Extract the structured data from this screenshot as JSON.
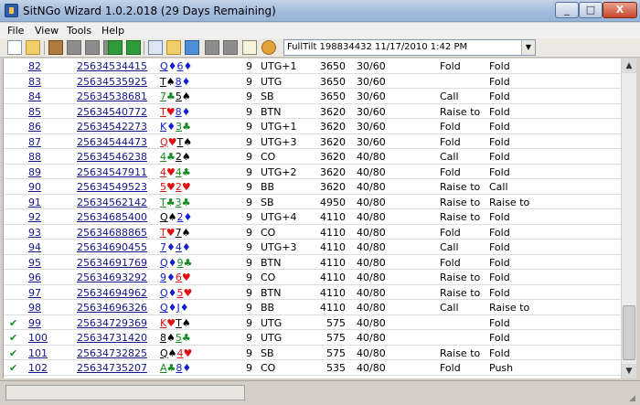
{
  "window": {
    "title": "SitNGo Wizard 1.0.2.018 (29 Days Remaining)",
    "controls": {
      "minimize": "_",
      "maximize": "□",
      "close": "X"
    }
  },
  "menu": [
    "File",
    "View",
    "Tools",
    "Help"
  ],
  "toolbar": {
    "icons": [
      "new-document-icon",
      "open-folder-icon",
      "home-icon",
      "stop-icon",
      "stop-icon",
      "stop-icon",
      "go-icon",
      "refresh-icon",
      "copy-icon",
      "paste-icon",
      "image-icon",
      "stop-icon",
      "stop-icon",
      "edit-icon",
      "settings-icon"
    ]
  },
  "session": {
    "selected": "FullTilt 198834432 11/17/2010 1:42 PM"
  },
  "rows": [
    {
      "check": "",
      "num": "82",
      "hand": "25634534415",
      "c1r": "Q",
      "c1s": "♦",
      "c1c": "blue",
      "c2r": "6",
      "c2s": "♦",
      "c2c": "blue",
      "players": "9",
      "pos": "UTG+1",
      "stack": "3650",
      "blinds": "30/60",
      "a1": "Fold",
      "a2": "Fold"
    },
    {
      "check": "",
      "num": "83",
      "hand": "25634535925",
      "c1r": "T",
      "c1s": "♠",
      "c1c": "black",
      "c2r": "8",
      "c2s": "♦",
      "c2c": "blue",
      "players": "9",
      "pos": "UTG",
      "stack": "3650",
      "blinds": "30/60",
      "a1": "",
      "a2": "Fold"
    },
    {
      "check": "",
      "num": "84",
      "hand": "25634538681",
      "c1r": "7",
      "c1s": "♣",
      "c1c": "green",
      "c2r": "5",
      "c2s": "♠",
      "c2c": "black",
      "players": "9",
      "pos": "SB",
      "stack": "3650",
      "blinds": "30/60",
      "a1": "Call",
      "a2": "Fold"
    },
    {
      "check": "",
      "num": "85",
      "hand": "25634540772",
      "c1r": "T",
      "c1s": "♥",
      "c1c": "red",
      "c2r": "8",
      "c2s": "♦",
      "c2c": "blue",
      "players": "9",
      "pos": "BTN",
      "stack": "3620",
      "blinds": "30/60",
      "a1": "Raise to",
      "a2": "Fold"
    },
    {
      "check": "",
      "num": "86",
      "hand": "25634542273",
      "c1r": "K",
      "c1s": "♦",
      "c1c": "blue",
      "c2r": "3",
      "c2s": "♣",
      "c2c": "green",
      "players": "9",
      "pos": "UTG+1",
      "stack": "3620",
      "blinds": "30/60",
      "a1": "Fold",
      "a2": "Fold"
    },
    {
      "check": "",
      "num": "87",
      "hand": "25634544473",
      "c1r": "Q",
      "c1s": "♥",
      "c1c": "red",
      "c2r": "T",
      "c2s": "♠",
      "c2c": "black",
      "players": "9",
      "pos": "UTG+3",
      "stack": "3620",
      "blinds": "30/60",
      "a1": "Fold",
      "a2": "Fold"
    },
    {
      "check": "",
      "num": "88",
      "hand": "25634546238",
      "c1r": "4",
      "c1s": "♣",
      "c1c": "green",
      "c2r": "2",
      "c2s": "♠",
      "c2c": "black",
      "players": "9",
      "pos": "CO",
      "stack": "3620",
      "blinds": "40/80",
      "a1": "Call",
      "a2": "Fold"
    },
    {
      "check": "",
      "num": "89",
      "hand": "25634547911",
      "c1r": "4",
      "c1s": "♥",
      "c1c": "red",
      "c2r": "4",
      "c2s": "♣",
      "c2c": "green",
      "players": "9",
      "pos": "UTG+2",
      "stack": "3620",
      "blinds": "40/80",
      "a1": "Fold",
      "a2": "Fold"
    },
    {
      "check": "",
      "num": "90",
      "hand": "25634549523",
      "c1r": "5",
      "c1s": "♥",
      "c1c": "red",
      "c2r": "2",
      "c2s": "♥",
      "c2c": "red",
      "players": "9",
      "pos": "BB",
      "stack": "3620",
      "blinds": "40/80",
      "a1": "Raise to",
      "a2": "Call"
    },
    {
      "check": "",
      "num": "91",
      "hand": "25634562142",
      "c1r": "T",
      "c1s": "♣",
      "c1c": "green",
      "c2r": "3",
      "c2s": "♣",
      "c2c": "green",
      "players": "9",
      "pos": "SB",
      "stack": "4950",
      "blinds": "40/80",
      "a1": "Raise to",
      "a2": "Raise to"
    },
    {
      "check": "",
      "num": "92",
      "hand": "25634685400",
      "c1r": "Q",
      "c1s": "♠",
      "c1c": "black",
      "c2r": "2",
      "c2s": "♦",
      "c2c": "blue",
      "players": "9",
      "pos": "UTG+4",
      "stack": "4110",
      "blinds": "40/80",
      "a1": "Raise to",
      "a2": "Fold"
    },
    {
      "check": "",
      "num": "93",
      "hand": "25634688865",
      "c1r": "T",
      "c1s": "♥",
      "c1c": "red",
      "c2r": "7",
      "c2s": "♠",
      "c2c": "black",
      "players": "9",
      "pos": "CO",
      "stack": "4110",
      "blinds": "40/80",
      "a1": "Fold",
      "a2": "Fold"
    },
    {
      "check": "",
      "num": "94",
      "hand": "25634690455",
      "c1r": "7",
      "c1s": "♦",
      "c1c": "blue",
      "c2r": "4",
      "c2s": "♦",
      "c2c": "blue",
      "players": "9",
      "pos": "UTG+3",
      "stack": "4110",
      "blinds": "40/80",
      "a1": "Call",
      "a2": "Fold"
    },
    {
      "check": "",
      "num": "95",
      "hand": "25634691769",
      "c1r": "Q",
      "c1s": "♦",
      "c1c": "blue",
      "c2r": "9",
      "c2s": "♣",
      "c2c": "green",
      "players": "9",
      "pos": "BTN",
      "stack": "4110",
      "blinds": "40/80",
      "a1": "Fold",
      "a2": "Fold"
    },
    {
      "check": "",
      "num": "96",
      "hand": "25634693292",
      "c1r": "9",
      "c1s": "♦",
      "c1c": "blue",
      "c2r": "6",
      "c2s": "♥",
      "c2c": "red",
      "players": "9",
      "pos": "CO",
      "stack": "4110",
      "blinds": "40/80",
      "a1": "Raise to",
      "a2": "Fold"
    },
    {
      "check": "",
      "num": "97",
      "hand": "25634694962",
      "c1r": "Q",
      "c1s": "♦",
      "c1c": "blue",
      "c2r": "5",
      "c2s": "♥",
      "c2c": "red",
      "players": "9",
      "pos": "BTN",
      "stack": "4110",
      "blinds": "40/80",
      "a1": "Raise to",
      "a2": "Fold"
    },
    {
      "check": "",
      "num": "98",
      "hand": "25634696326",
      "c1r": "Q",
      "c1s": "♦",
      "c1c": "blue",
      "c2r": "J",
      "c2s": "♦",
      "c2c": "blue",
      "players": "9",
      "pos": "BB",
      "stack": "4110",
      "blinds": "40/80",
      "a1": "Call",
      "a2": "Raise to"
    },
    {
      "check": "✔",
      "num": "99",
      "hand": "25634729369",
      "c1r": "K",
      "c1s": "♥",
      "c1c": "red",
      "c2r": "T",
      "c2s": "♠",
      "c2c": "black",
      "players": "9",
      "pos": "UTG",
      "stack": "575",
      "blinds": "40/80",
      "a1": "",
      "a2": "Fold"
    },
    {
      "check": "✔",
      "num": "100",
      "hand": "25634731420",
      "c1r": "8",
      "c1s": "♠",
      "c1c": "black",
      "c2r": "5",
      "c2s": "♣",
      "c2c": "green",
      "players": "9",
      "pos": "UTG",
      "stack": "575",
      "blinds": "40/80",
      "a1": "",
      "a2": "Fold"
    },
    {
      "check": "✔",
      "num": "101",
      "hand": "25634732825",
      "c1r": "Q",
      "c1s": "♠",
      "c1c": "black",
      "c2r": "4",
      "c2s": "♥",
      "c2c": "red",
      "players": "9",
      "pos": "SB",
      "stack": "575",
      "blinds": "40/80",
      "a1": "Raise to",
      "a2": "Fold"
    },
    {
      "check": "✔",
      "num": "102",
      "hand": "25634735207",
      "c1r": "A",
      "c1s": "♣",
      "c1c": "green",
      "c2r": "8",
      "c2s": "♦",
      "c2c": "blue",
      "players": "9",
      "pos": "CO",
      "stack": "535",
      "blinds": "40/80",
      "a1": "Fold",
      "a2": "Push"
    }
  ],
  "scrollbar": {
    "up": "▲",
    "down": "▼"
  }
}
